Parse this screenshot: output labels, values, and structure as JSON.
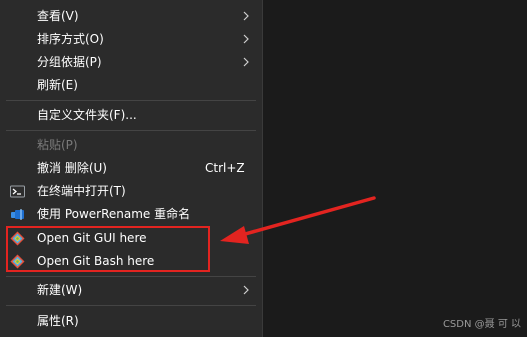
{
  "menu": {
    "items": [
      {
        "label": "查看(V)",
        "submenu": true
      },
      {
        "label": "排序方式(O)",
        "submenu": true
      },
      {
        "label": "分组依据(P)",
        "submenu": true
      },
      {
        "label": "刷新(E)"
      },
      {
        "label": "自定义文件夹(F)..."
      },
      {
        "label": "粘贴(P)",
        "disabled": true
      },
      {
        "label": "撤消 删除(U)",
        "shortcut": "Ctrl+Z"
      },
      {
        "label": "在终端中打开(T)",
        "icon": "terminal-icon"
      },
      {
        "label": "使用 PowerRename 重命名",
        "icon": "powerrename-icon"
      },
      {
        "label": "Open Git GUI here",
        "icon": "git-icon"
      },
      {
        "label": "Open Git Bash here",
        "icon": "git-icon"
      },
      {
        "label": "新建(W)",
        "submenu": true
      },
      {
        "label": "属性(R)"
      }
    ]
  },
  "annotation": {
    "highlight_color": "#e32420"
  },
  "watermark": "CSDN @聂 可 以"
}
